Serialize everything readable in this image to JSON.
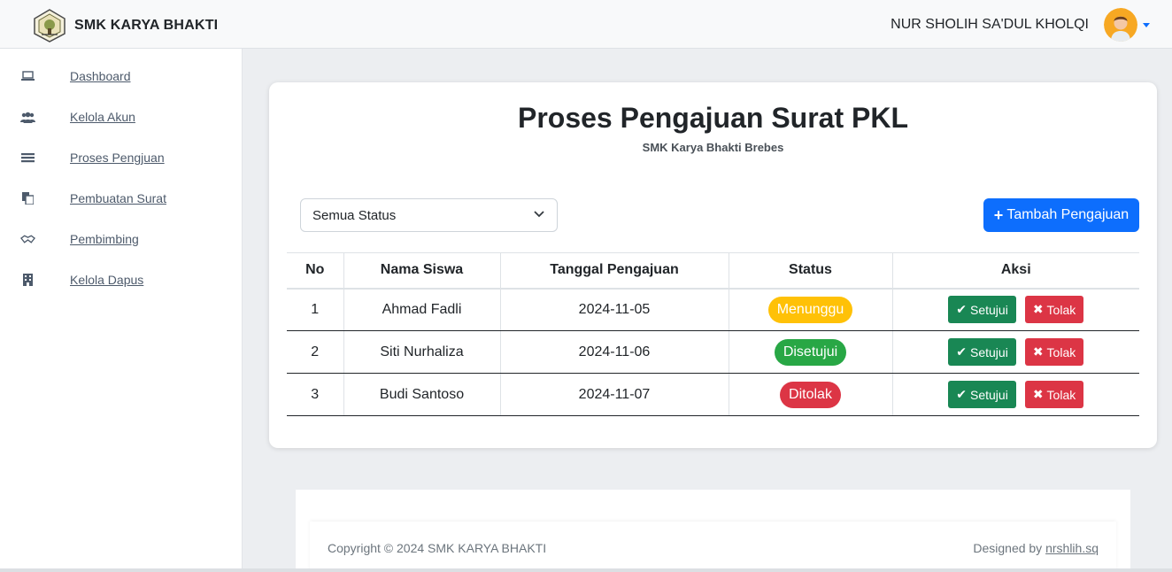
{
  "brand": {
    "name": "SMK KARYA BHAKTI",
    "logo": "school-emblem-icon"
  },
  "user": {
    "name": "NUR SHOLIH SA'DUL KHOLQI",
    "avatar": "user-avatar"
  },
  "sidebar": {
    "items": [
      {
        "label": "Dashboard",
        "icon": "laptop-icon"
      },
      {
        "label": "Kelola Akun",
        "icon": "users-icon"
      },
      {
        "label": "Proses Pengjuan",
        "icon": "list-icon"
      },
      {
        "label": "Pembuatan Surat",
        "icon": "documents-icon"
      },
      {
        "label": "Pembimbing",
        "icon": "handshake-icon"
      },
      {
        "label": "Kelola Dapus",
        "icon": "building-icon"
      }
    ]
  },
  "main": {
    "title": "Proses Pengajuan Surat PKL",
    "subtitle": "SMK Karya Bhakti Brebes",
    "filter": {
      "selected": "Semua Status"
    },
    "add_button": {
      "icon": "+",
      "label": "Tambah Pengajuan"
    },
    "table": {
      "headers": [
        "No",
        "Nama Siswa",
        "Tanggal Pengajuan",
        "Status",
        "Aksi"
      ],
      "rows": [
        {
          "no": "1",
          "name": "Ahmad Fadli",
          "date": "2024-11-05",
          "status": "Menunggu"
        },
        {
          "no": "2",
          "name": "Siti Nurhaliza",
          "date": "2024-11-06",
          "status": "Disetujui"
        },
        {
          "no": "3",
          "name": "Budi Santoso",
          "date": "2024-11-07",
          "status": "Ditolak"
        }
      ],
      "approve_label": "Setujui",
      "reject_label": "Tolak",
      "approve_glyph": "✔",
      "reject_glyph": "✖"
    }
  },
  "footer": {
    "copyright": "Copyright © 2024 SMK KARYA BHAKTI",
    "designed_prefix": "Designed by ",
    "designed_link": "nrshlih.sq"
  },
  "colors": {
    "primary": "#0d6efd",
    "success": "#198754",
    "danger": "#dc3545",
    "badge_waiting": "#ffc107",
    "badge_approved": "#28a745",
    "badge_rejected": "#dc3545"
  }
}
